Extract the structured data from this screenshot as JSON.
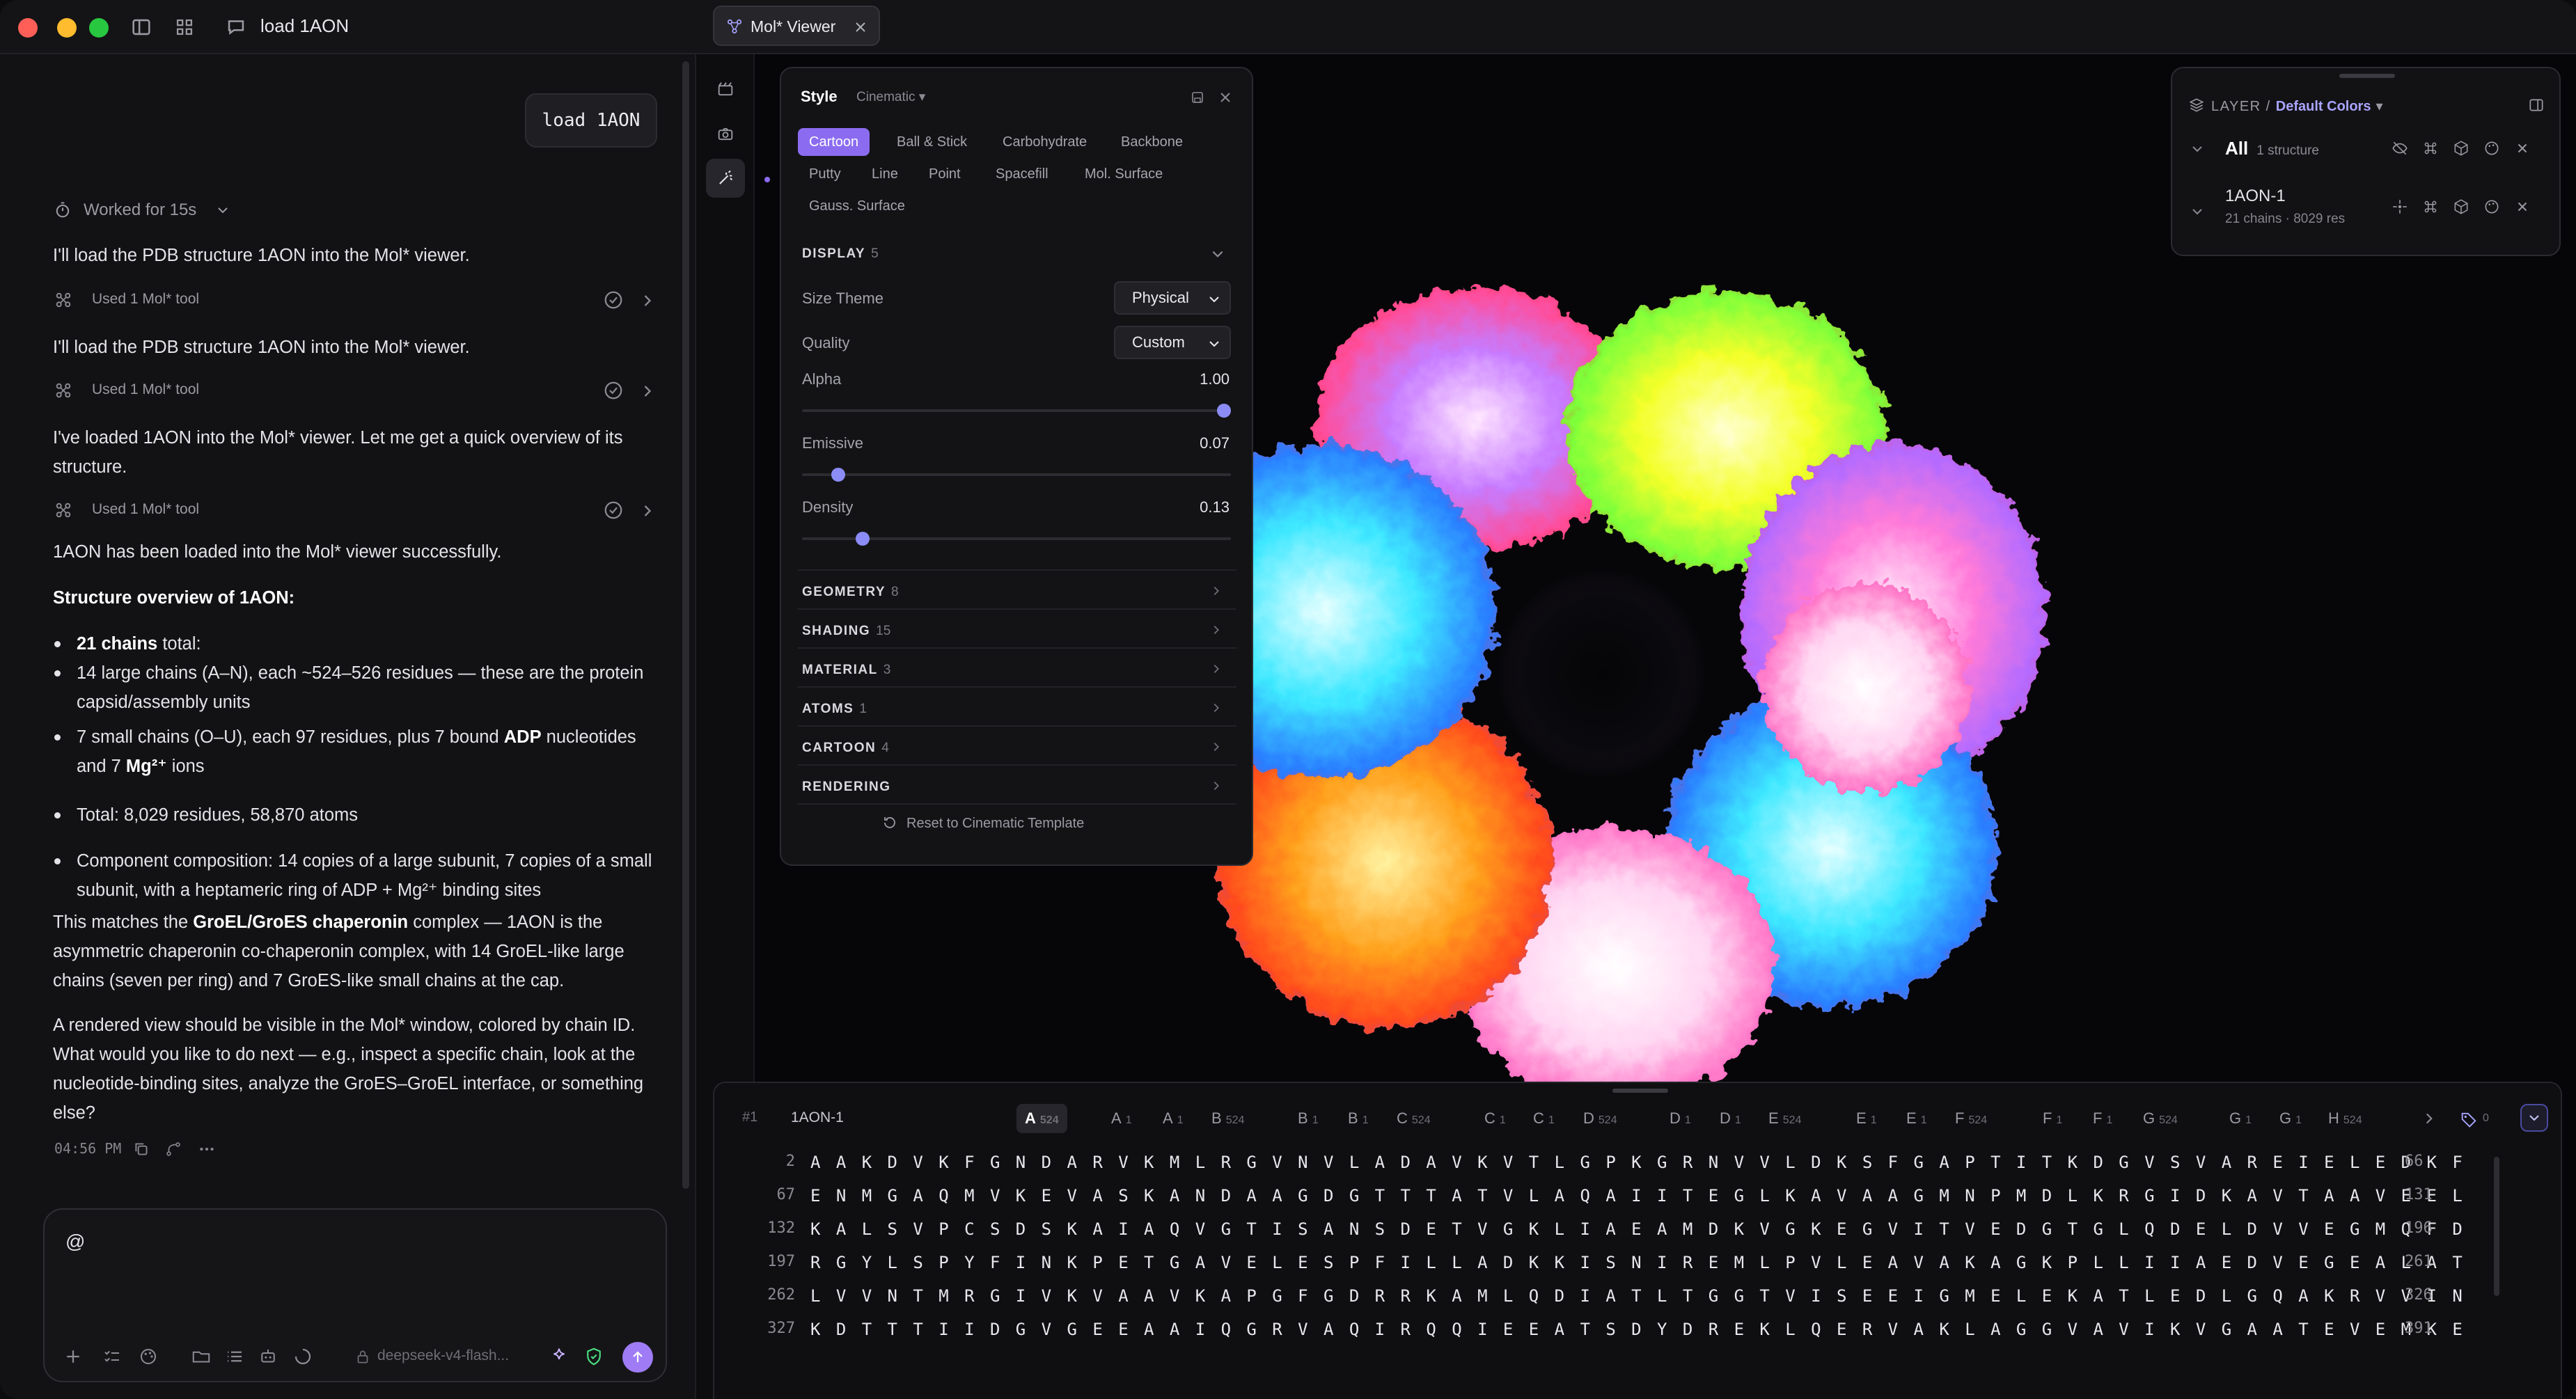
{
  "titlebar": {
    "title": "load 1AON",
    "tab_label": "Mol* Viewer"
  },
  "chat": {
    "user_message": "load 1AON",
    "worked_label": "Worked for 15s",
    "p1": "I'll load the PDB structure 1AON into the Mol* viewer.",
    "tool1": "Used 1 Mol* tool",
    "p2": "I'll load the PDB structure 1AON into the Mol* viewer.",
    "tool2": "Used 1 Mol* tool",
    "p3": "I've loaded 1AON into the Mol* viewer. Let me get a quick overview of its structure.",
    "tool3": "Used 1 Mol* tool",
    "p4": "1AON has been loaded into the Mol* viewer successfully.",
    "overview_heading": "Structure overview of 1AON:",
    "b1_bold": "21 chains",
    "b1_rest": " total:",
    "b1a": "14 large chains (A–N), each ~524–526 residues — these are the protein capsid/assembly units",
    "b1b_pre": "7 small chains (O–U), each 97 residues, plus 7 bound ",
    "b1b_bold1": "ADP",
    "b1b_mid": " nucleotides and 7 ",
    "b1b_bold2": "Mg²⁺",
    "b1b_post": " ions",
    "b2": "Total: 8,029 residues, 58,870 atoms",
    "b3": "Component composition: 14 copies of a large subunit, 7 copies of a small subunit, with a heptameric ring of ADP + Mg²⁺ binding sites",
    "p5_pre": "This matches the ",
    "p5_bold": "GroEL/GroES chaperonin",
    "p5_post": " complex — 1AON is the asymmetric chaperonin co-chaperonin complex, with 14 GroEL-like large chains (seven per ring) and 7 GroES-like small chains at the cap.",
    "p6": "A rendered view should be visible in the Mol* window, colored by chain ID. What would you like to do next — e.g., inspect a specific chain, look at the nucleotide-binding sites, analyze the GroES–GroEL interface, or something else?",
    "time": "04:56 PM",
    "composer_value": "@",
    "model_label": "deepseek-v4-flash..."
  },
  "style_panel": {
    "title": "Style",
    "preset": "Cinematic",
    "reps": [
      "Cartoon",
      "Ball & Stick",
      "Carbohydrate",
      "Backbone",
      "Putty",
      "Line",
      "Point",
      "Spacefill",
      "Mol. Surface",
      "Gauss. Surface"
    ],
    "display_label": "DISPLAY",
    "display_count": "5",
    "size_theme_label": "Size Theme",
    "size_theme_value": "Physical",
    "quality_label": "Quality",
    "quality_value": "Custom",
    "alpha_label": "Alpha",
    "alpha_value": "1.00",
    "alpha_level": 1.0,
    "emissive_label": "Emissive",
    "emissive_value": "0.07",
    "emissive_level": 0.07,
    "density_label": "Density",
    "density_value": "0.13",
    "density_level": 0.13,
    "sections": [
      {
        "label": "GEOMETRY",
        "count": "8"
      },
      {
        "label": "SHADING",
        "count": "15"
      },
      {
        "label": "MATERIAL",
        "count": "3"
      },
      {
        "label": "ATOMS",
        "count": "1"
      },
      {
        "label": "CARTOON",
        "count": "4"
      },
      {
        "label": "RENDERING",
        "count": ""
      }
    ],
    "reset_label": "Reset to Cinematic Template"
  },
  "layer_panel": {
    "layer_label": "LAYER",
    "colors_label": "Default Colors",
    "all_label": "All",
    "all_meta": "1 structure",
    "entry_name": "1AON-1",
    "entry_meta": "21 chains · 8029 res"
  },
  "sequence": {
    "entry_index": "#1",
    "entry_name": "1AON-1",
    "chains": [
      {
        "id": "A",
        "count": "524"
      },
      {
        "id": "A",
        "count": "1"
      },
      {
        "id": "A",
        "count": "1"
      },
      {
        "id": "B",
        "count": "524"
      },
      {
        "id": "B",
        "count": "1"
      },
      {
        "id": "B",
        "count": "1"
      },
      {
        "id": "C",
        "count": "524"
      },
      {
        "id": "C",
        "count": "1"
      },
      {
        "id": "C",
        "count": "1"
      },
      {
        "id": "D",
        "count": "524"
      },
      {
        "id": "D",
        "count": "1"
      },
      {
        "id": "D",
        "count": "1"
      },
      {
        "id": "E",
        "count": "524"
      },
      {
        "id": "E",
        "count": "1"
      },
      {
        "id": "E",
        "count": "1"
      },
      {
        "id": "F",
        "count": "524"
      },
      {
        "id": "F",
        "count": "1"
      },
      {
        "id": "F",
        "count": "1"
      },
      {
        "id": "G",
        "count": "524"
      },
      {
        "id": "G",
        "count": "1"
      },
      {
        "id": "G",
        "count": "1"
      },
      {
        "id": "H",
        "count": "524"
      }
    ],
    "filter_count": "0",
    "lines": [
      {
        "start": "2",
        "residues": "AAKDVKFGNDARVKMLRGVNVLADAVKVTLGPKGRNVVLDKSFGAPTITKDGVSVAREIELEDKF",
        "end": "66"
      },
      {
        "start": "67",
        "residues": "ENMGAQMVKEVASKANDAAGDGTTTATVLAQAIITEGLKAVAAGMNPMDLKRGIDKAVTAAVEEL",
        "end": "131"
      },
      {
        "start": "132",
        "residues": "KALSVPCSDSKAIAQVGTISANSDETVGKLIAEAMDKVGKEGVITVEDGTGLQDELDVVEGMQFD",
        "end": "196"
      },
      {
        "start": "197",
        "residues": "RGYLSPYFINKPETGAVELESPFILLADKKISNIREMLPVLEAVAKAGKPLLIIAEDVEGEALAT",
        "end": "261"
      },
      {
        "start": "262",
        "residues": "LVVNTMRGIVKVAAVKAPGFGDRRKAMLQDIATLTGGTVISEEIGMELEKATLEDLGQAKRVVIN",
        "end": "326"
      },
      {
        "start": "327",
        "residues": "KDTTTIIDGVGEEAAIQGRVAQIRQQIEEATSDYDREKLQERVAKLAGGVAVIKVGAATEVEMKE",
        "end": "391"
      }
    ]
  }
}
